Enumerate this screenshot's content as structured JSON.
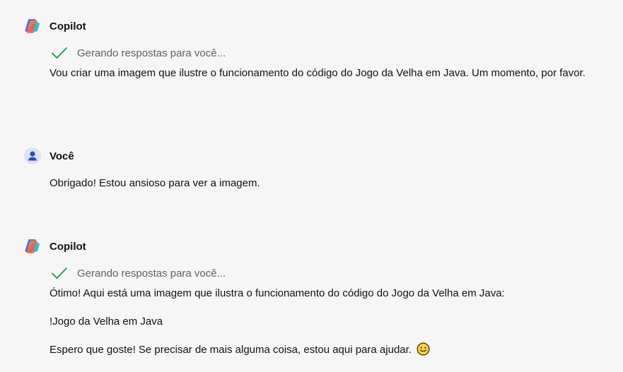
{
  "conversation": {
    "messages": [
      {
        "author": "Copilot",
        "status": "Gerando respostas para você...",
        "paragraphs": [
          "Vou criar uma imagem que ilustre o funcionamento do código do Jogo da Velha em Java. Um momento, por favor."
        ]
      },
      {
        "author": "Você",
        "paragraphs": [
          "Obrigado! Estou ansioso para ver a imagem."
        ]
      },
      {
        "author": "Copilot",
        "status": "Gerando respostas para você...",
        "paragraphs": [
          "Ótimo! Aqui está uma imagem que ilustra o funcionamento do código do Jogo da Velha em Java:",
          "!Jogo da Velha em Java",
          "Espero que goste! Se precisar de mais alguma coisa, estou aqui para ajudar."
        ]
      }
    ]
  },
  "icons": {
    "copilot_logo": "copilot-logo-icon",
    "user_avatar": "user-avatar-icon",
    "status_check": "checkmark-icon",
    "emoji": "smiling-face-emoji-icon"
  },
  "colors": {
    "background": "#f6f6f6",
    "text": "#111111",
    "status_text": "#616161",
    "check_green": "#1a9c3a",
    "user_avatar_bg": "#dce3f7",
    "user_avatar_fg": "#2b4fb3"
  }
}
